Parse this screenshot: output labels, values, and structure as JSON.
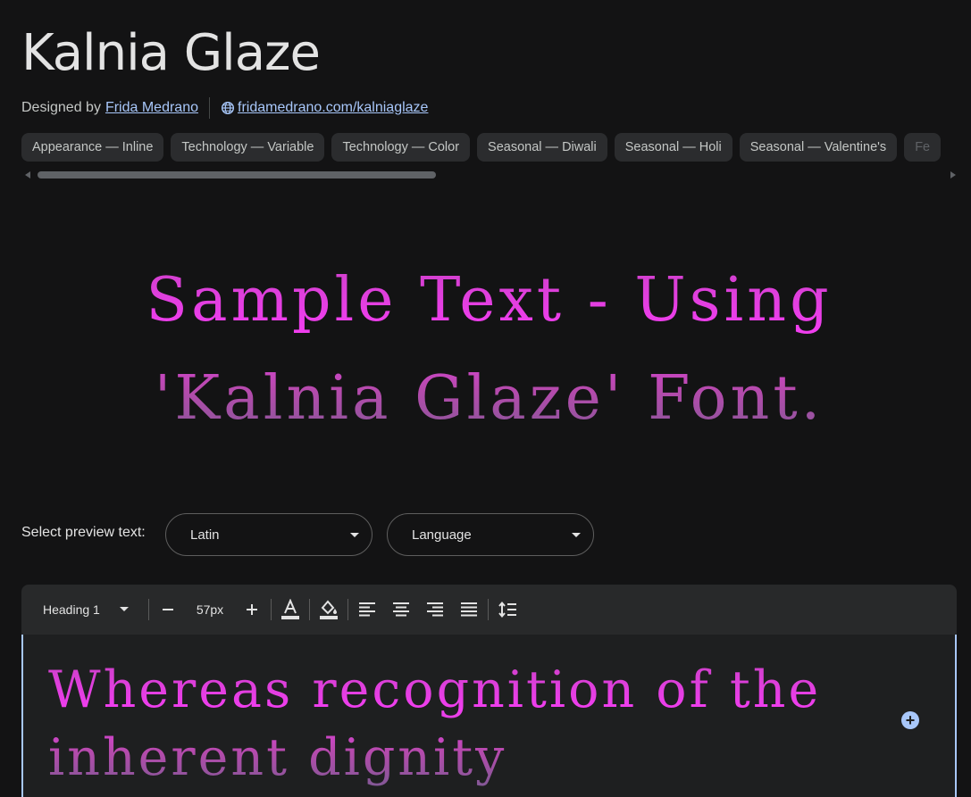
{
  "font": {
    "name": "Kalnia Glaze",
    "designed_by_label": "Designed by",
    "designer": "Frida Medrano",
    "website": " fridamedrano.com/kalniaglaze"
  },
  "tags": [
    "Appearance — Inline",
    "Technology — Variable",
    "Technology — Color",
    "Seasonal — Diwali",
    "Seasonal — Holi",
    "Seasonal — Valentine's",
    "Fe"
  ],
  "sample_text": "Sample Text - Using 'Kalnia Glaze' Font.",
  "preview": {
    "label": "Select preview text:",
    "script_value": "Latin",
    "language_placeholder": "Language"
  },
  "toolbar": {
    "style_value": "Heading 1",
    "size_value": "57px",
    "icons": [
      "minus-icon",
      "plus-icon",
      "text-color-icon",
      "fill-color-icon",
      "align-left-icon",
      "align-center-icon",
      "align-right-icon",
      "align-justify-icon",
      "line-height-icon"
    ]
  },
  "editor": {
    "text": "Whereas recognition of the inherent dignity"
  },
  "colors": {
    "background": "#131314",
    "link": "#a8c7fa",
    "glaze_pink": "#f13ef0",
    "glaze_purple": "#7b5a92"
  }
}
